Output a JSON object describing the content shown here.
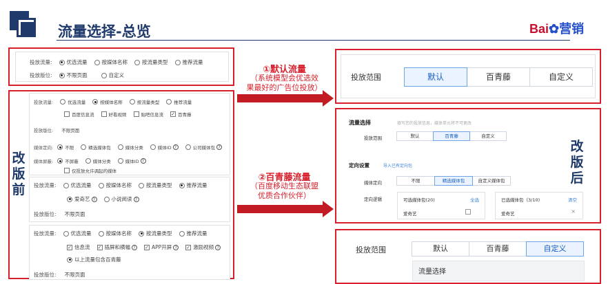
{
  "header": {
    "title": "流量选择-总览",
    "brand_bai": "Bai",
    "brand_paw": "✿",
    "brand_cn": "营销"
  },
  "top_left": {
    "row1_label": "投放流量:",
    "row1_options": [
      "优选流量",
      "按媒体名称",
      "按流量类型",
      "推荐流量"
    ],
    "row2_label": "投放版位:",
    "row2_options": [
      "不限页面",
      "自定义"
    ]
  },
  "annotations": {
    "a1_title": "①默认流量",
    "a1_line1": "（系统模型会优选效",
    "a1_line2": "果最好的广告位投放）",
    "a2_title": "②百青藤流量",
    "a2_line1": "（百度移动生态联盟",
    "a2_line2": "优质合作伙伴）"
  },
  "side_labels": {
    "before": "改版前",
    "after": "改版后"
  },
  "before": {
    "p1_row1_label": "投放流量:",
    "p1_row1_options": [
      "优选流量",
      "按媒体名称",
      "按流量类型",
      "推荐流量"
    ],
    "p1_row2_checks": [
      "百度信息流",
      "好看视频",
      "贴吧信息流",
      "百青藤"
    ],
    "p1_row3_label": "投放版位:",
    "p1_row3_value": "不限页面",
    "p1_row4_label": "媒体定向:",
    "p1_row4_options": [
      "不限",
      "精选媒体包",
      "媒体分类",
      "媒体ID",
      "公司媒体包"
    ],
    "p1_row5_label": "媒体屏蔽:",
    "p1_row5_options": [
      "不屏蔽",
      "媒体分类",
      "媒体ID"
    ],
    "p1_row6_check": "仅投放允许调起的媒体",
    "p2_row1_label": "投放流量:",
    "p2_row1_options": [
      "优选流量",
      "按媒体名称",
      "按流量类型",
      "推荐流量"
    ],
    "p2_row2_options": [
      "爱奇艺",
      "小说阅读"
    ],
    "p2_row3_label": "投放版位:",
    "p2_row3_value": "不限页面",
    "p3_row1_label": "投放流量:",
    "p3_row1_options": [
      "优选流量",
      "按媒体名称",
      "按流量类型",
      "推荐流量"
    ],
    "p3_row2_checks": [
      "信息流",
      "插屏和横幅",
      "APP开屏",
      "激励视频"
    ],
    "p3_row3_option": "以上流量包含百青藤",
    "p3_row4_label": "投放版位:",
    "p3_row4_value": "不限页面"
  },
  "after": {
    "r1_label": "投放范围",
    "r1_options": [
      "默认",
      "百青藤",
      "自定义"
    ],
    "mid_title": "流量选择",
    "mid_hint": "填写您的投放信息，媒体单元将不可更改",
    "mid_row1_label": "投放范围",
    "mid_row1_options": [
      "默认",
      "百青藤",
      "自定义"
    ],
    "mid_section2": "定向设置",
    "mid_section2_link": "导入已有定向包",
    "mid_row2_label": "媒体定向",
    "mid_row2_options": [
      "不限",
      "精选媒体包",
      "自定义媒体包"
    ],
    "mid_row3_label": "定向逻辑",
    "mid_left_header": "可选媒体包(20)",
    "mid_left_action": "全选",
    "mid_left_item": "爱奇艺",
    "mid_right_header": "已选媒体包（3/10)",
    "mid_right_action": "清空",
    "mid_right_item": "爱奇艺",
    "mid_right_remove": "×",
    "r3_label": "投放范围",
    "r3_options": [
      "默认",
      "百青藤",
      "自定义"
    ],
    "r3_sub": "流量选择"
  },
  "icons": {
    "help": "?",
    "check": "✓"
  }
}
